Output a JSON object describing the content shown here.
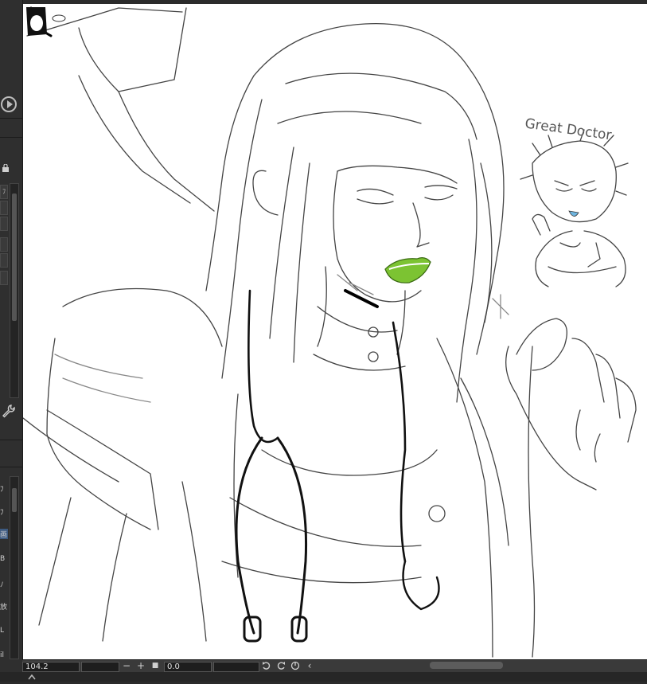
{
  "app": {
    "panel_glyphs": [
      "ﾌ",
      "ﾌ",
      "画",
      "B",
      "ﾉ",
      "放",
      "L",
      "il"
    ]
  },
  "statusbar": {
    "zoom_value": "104.2",
    "minus_label": "−",
    "plus_label": "+",
    "square_label": "■",
    "rotation_value": "0.0",
    "undo_icon": "undo-icon",
    "redo_icon": "redo-icon",
    "rotate_reset_icon": "rotate-reset-icon",
    "collapse_label": "‹"
  },
  "canvas": {
    "annotation_text": "Great Doctor",
    "lip_color": "#7cc332",
    "tongue_color": "#6fb6e0",
    "line_color": "#333333"
  }
}
